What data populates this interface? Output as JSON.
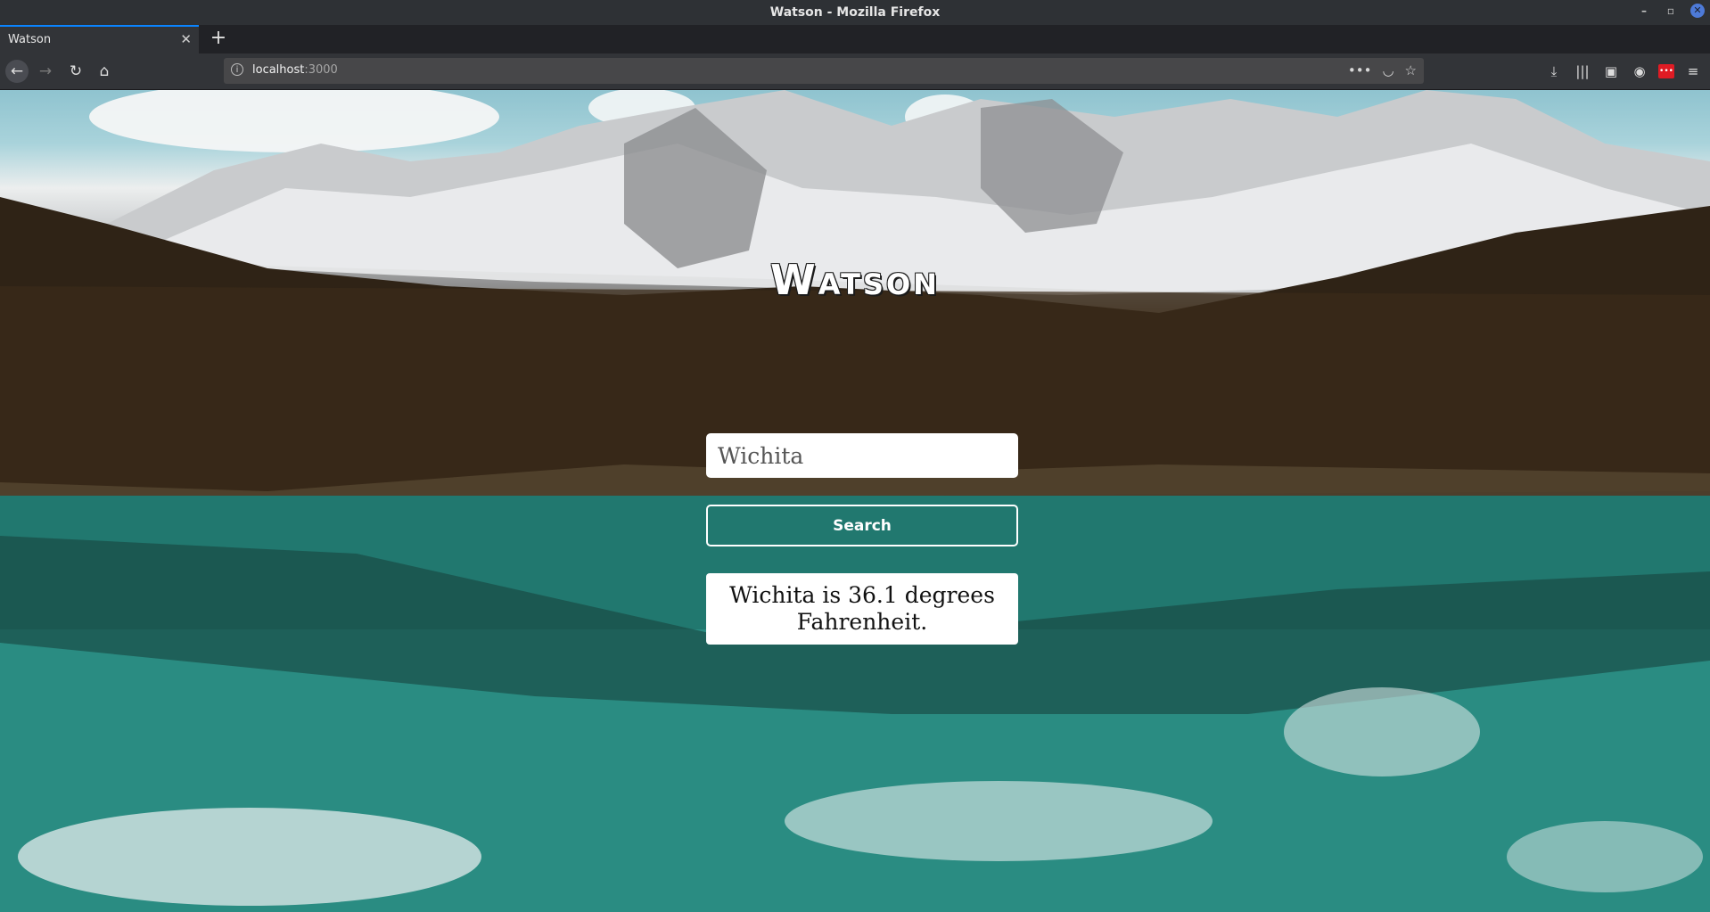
{
  "window": {
    "title": "Watson - Mozilla Firefox",
    "controls": {
      "minimize": "–",
      "maximize": "▫",
      "close": "✕"
    }
  },
  "tabs": [
    {
      "label": "Watson",
      "close": "✕"
    }
  ],
  "new_tab_label": "+",
  "nav": {
    "back": "←",
    "forward": "→",
    "reload": "↻",
    "home": "⌂",
    "info": "i",
    "url_host": "localhost",
    "url_port": ":3000",
    "page_actions": {
      "more": "•••",
      "pocket": "◡",
      "bookmark": "☆"
    }
  },
  "toolbar_icons": {
    "downloads": "⤓",
    "library": "|||",
    "sidebar": "▣",
    "account": "◉",
    "extension": "•••",
    "menu": "≡"
  },
  "colors": {
    "accent": "#0a84ff",
    "extension_red": "#e01b24",
    "button_border": "#ffffff"
  },
  "app": {
    "title": "Watson",
    "search_value": "Wichita",
    "search_button_label": "Search",
    "result_text": "Wichita is 36.1 degrees Fahrenheit."
  },
  "background": {
    "icon": "mountain-lake-photo"
  }
}
